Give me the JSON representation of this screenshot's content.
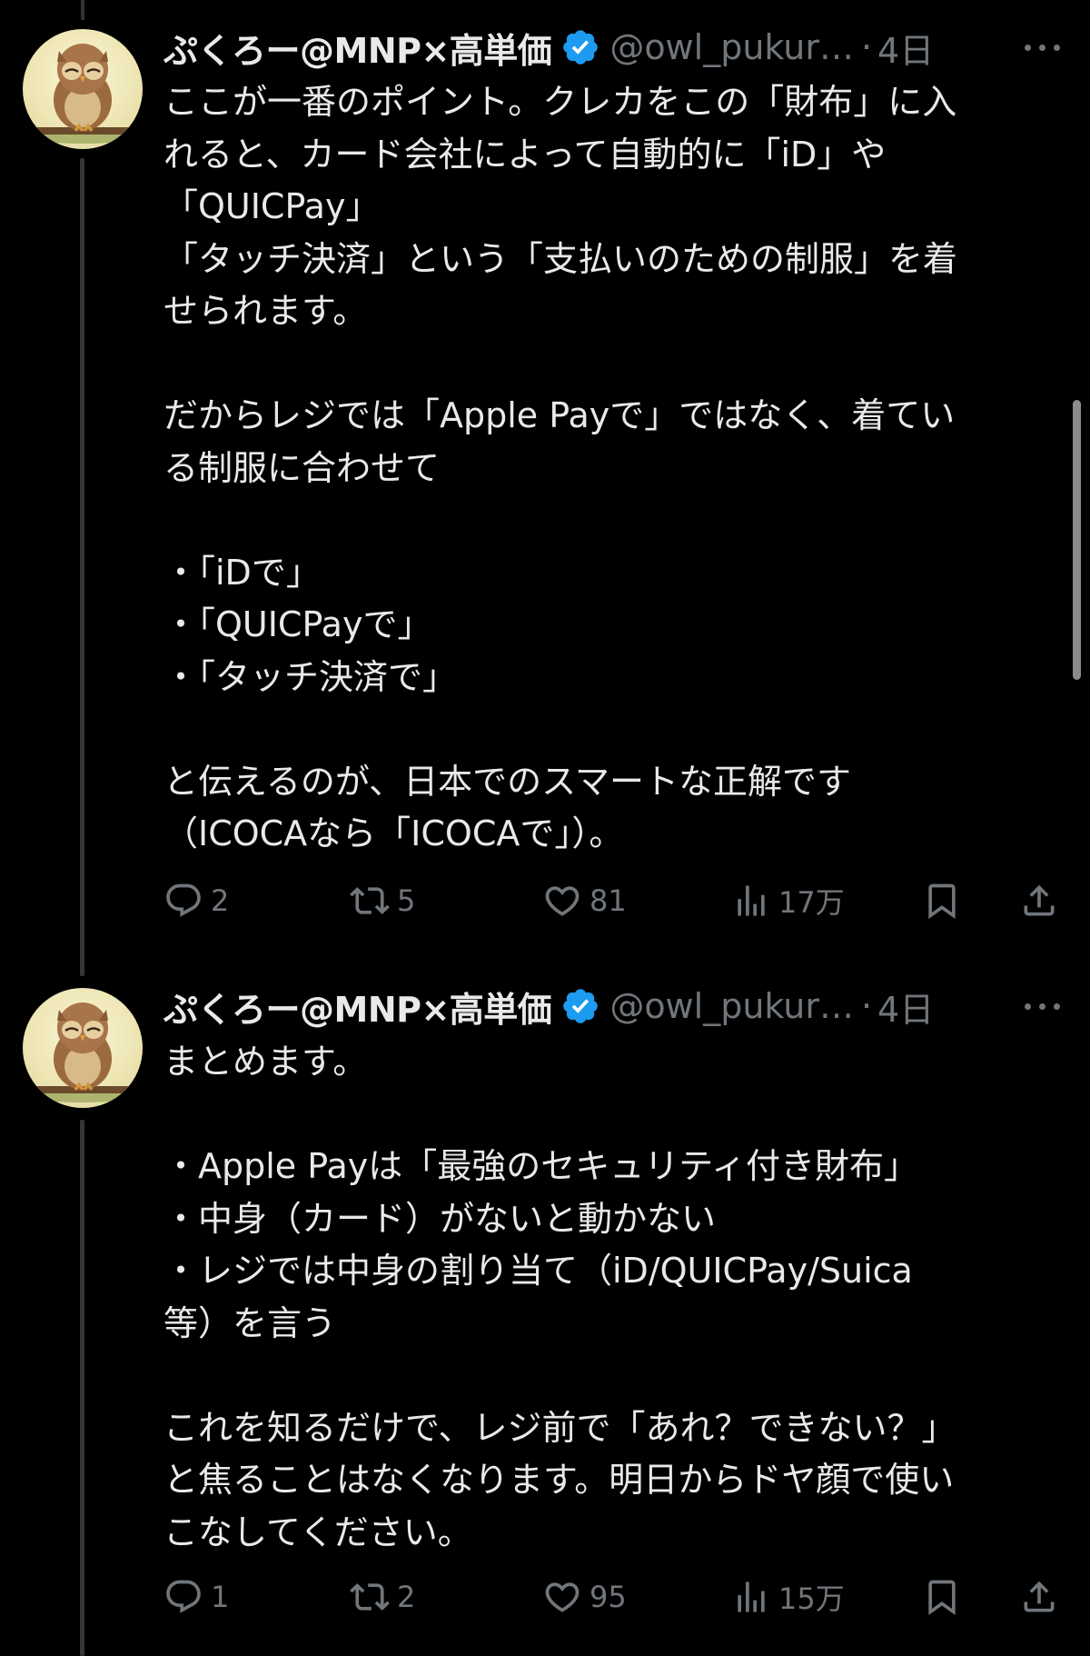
{
  "posts": [
    {
      "display_name": "ぷくろー@MNP×高単価",
      "handle": "@owl_pukur…",
      "separator": "·",
      "time": "4日",
      "avatar_icon": "owl-avatar-icon",
      "verified_icon": "verified-badge-icon",
      "body_lines": [
        "ここが一番のポイント。クレカをこの「財布」に入",
        "れると、カード会社によって自動的に「iD」や",
        "「QUICPay」",
        "「タッチ決済」という「支払いのための制服」を着",
        "せられます。",
        "",
        "だからレジでは「Apple Payで」ではなく、着てい",
        "る制服に合わせて",
        "",
        "・「iDで」",
        "・「QUICPayで」",
        "・「タッチ決済で」",
        "",
        "と伝えるのが、日本でのスマートな正解です",
        "（ICOCAなら「ICOCAで」）。"
      ],
      "actions": {
        "replies": "2",
        "reposts": "5",
        "likes": "81",
        "views": "17万"
      }
    },
    {
      "display_name": "ぷくろー@MNP×高単価",
      "handle": "@owl_pukur…",
      "separator": "·",
      "time": "4日",
      "avatar_icon": "owl-avatar-icon",
      "verified_icon": "verified-badge-icon",
      "body_lines": [
        "まとめます。",
        "",
        "・Apple Payは「最強のセキュリティ付き財布」",
        "・中身（カード）がないと動かない",
        "・レジでは中身の割り当て（iD/QUICPay/Suica",
        "等）を言う",
        "",
        "これを知るだけで、レジ前で「あれ？できない？」",
        "と焦ることはなくなります。明日からドヤ顔で使い",
        "こなしてください。"
      ],
      "actions": {
        "replies": "1",
        "reposts": "2",
        "likes": "95",
        "views": "15万"
      }
    }
  ],
  "colors": {
    "background": "#000000",
    "text": "#e7e9ea",
    "secondary": "#71767b",
    "verified": "#1d9bf0",
    "thread_line": "#333639"
  }
}
